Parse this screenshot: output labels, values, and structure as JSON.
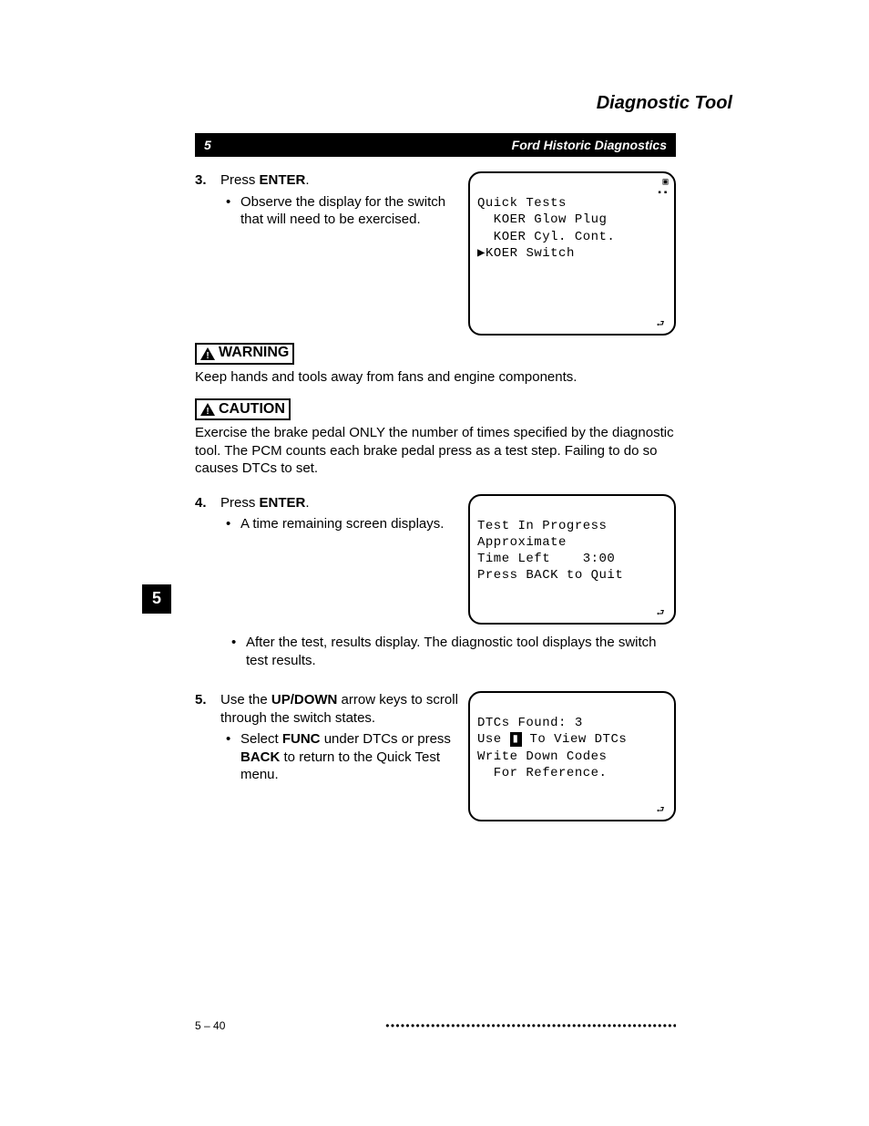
{
  "side_label": "Diagnostic Tool",
  "header": {
    "left": "5",
    "right": "Ford Historic Diagnostics"
  },
  "step3": {
    "num": "3.",
    "line1_a": "Press ",
    "key1": "ENTER",
    "line1_b": ".",
    "bullet_a": "Observe the display for the switch that will need to be exercised."
  },
  "warning_label": "WARNING",
  "warning_text": "Keep hands and tools away from fans and engine components.",
  "caution_label": "CAUTION",
  "caution_text": "Exercise the brake pedal ONLY the number of times specified by the diagnostic tool. The PCM counts each brake pedal press as a test step. Failing to do so causes DTCs to set.",
  "lcd1": {
    "l1": "Quick Tests",
    "l2": "  KOER Glow Plug",
    "l3": "  KOER Cyl. Cont.",
    "l4_cursor": "▶",
    "l4_text": "KOER Switch"
  },
  "step4": {
    "num": "4.",
    "line_a": "Press ",
    "key": "ENTER",
    "line_b": ".",
    "bullet_a": "A time remaining screen displays."
  },
  "bullet_afterlcd2": "After the test, results display. The diagnostic tool displays the switch test results.",
  "lcd2": {
    "l1": "Test In Progress",
    "l2": "Approximate",
    "l3": "Time Left    3:00",
    "l4": "Press BACK to Quit"
  },
  "pageno": "5",
  "step5": {
    "num": "5.",
    "line_a": "Use the ",
    "key1": "UP/DOWN",
    "line_b": " arrow keys to scroll through the switch states.",
    "bullet_pre": "Select ",
    "key2": "FUNC",
    "bullet_mid": " under DTCs or press ",
    "key3": "BACK",
    "bullet_post": " to return to the Quick Test menu."
  },
  "lcd3": {
    "l1": "DTCs Found: 3",
    "l2_a": "Use ",
    "l2_icon": "▮",
    "l2_b": " To View DTCs",
    "l3": "Write Down Codes",
    "l4": "  For Reference."
  },
  "footer": {
    "left": "5 – 40",
    "right": "• • • • • • • • • • • • • • • • • • • • • • • • • • • • • • • • • • • • • • • • • • • • • • • • • • • • • • • • • •"
  }
}
